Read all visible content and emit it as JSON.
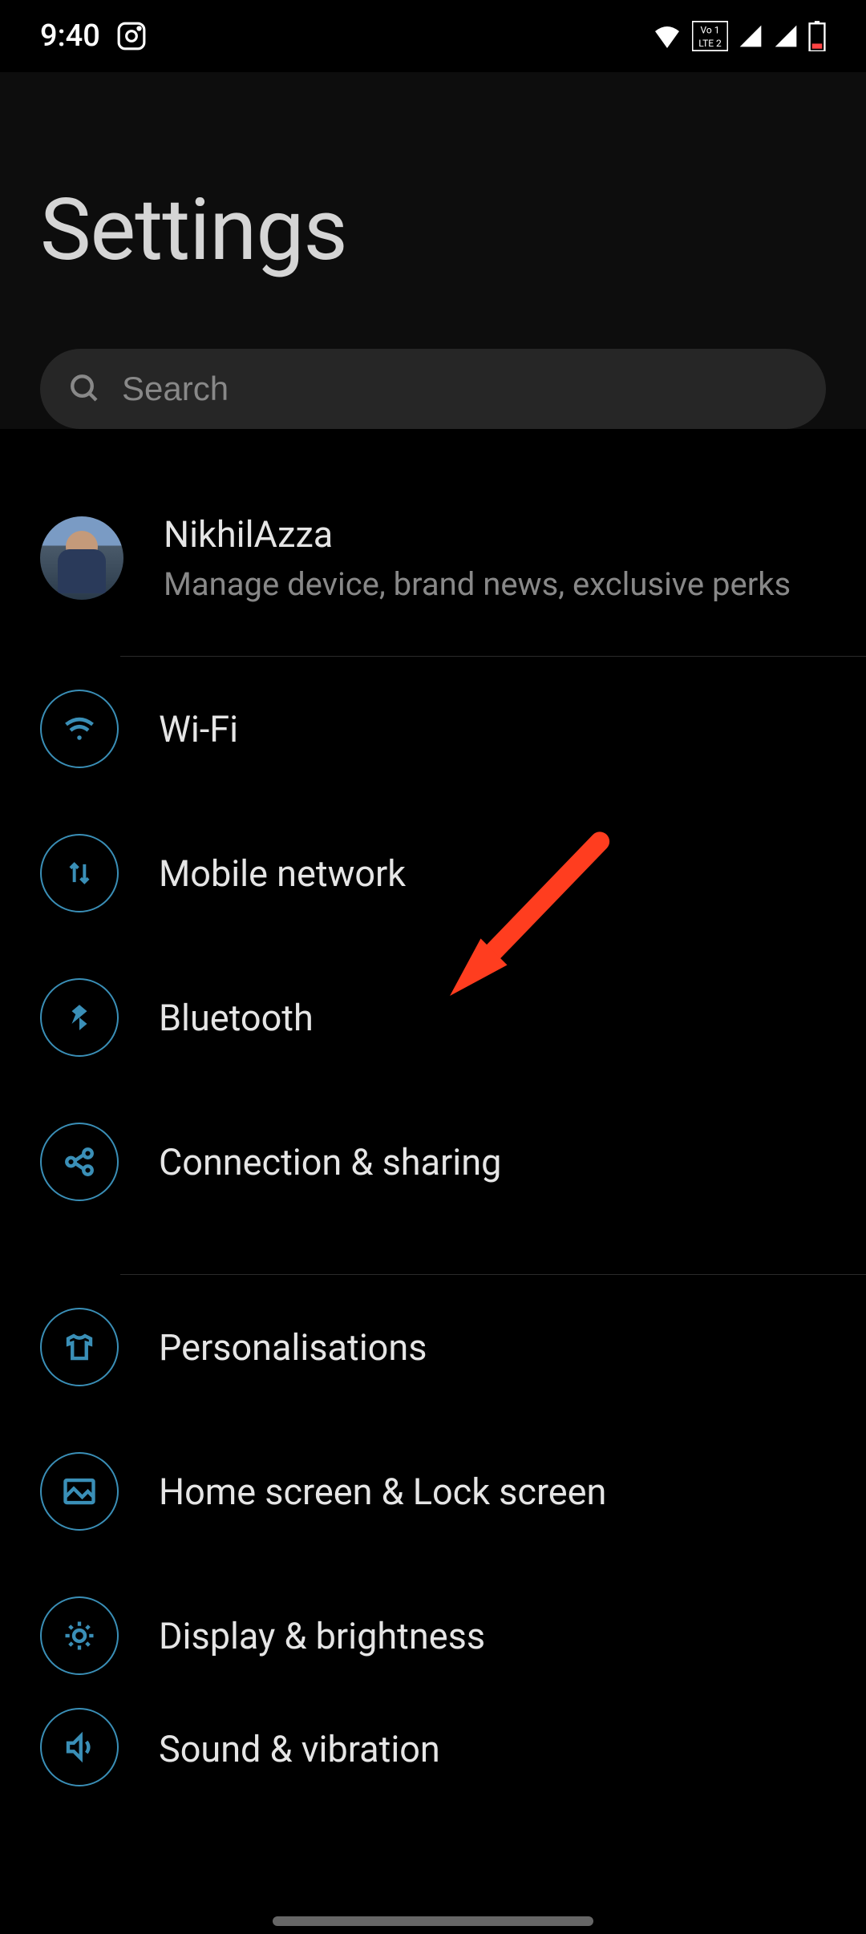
{
  "status": {
    "time": "9:40"
  },
  "header": {
    "title": "Settings"
  },
  "search": {
    "placeholder": "Search"
  },
  "account": {
    "name": "NikhilAzza",
    "subtitle": "Manage device, brand news, exclusive perks"
  },
  "items": [
    {
      "label": "Wi-Fi",
      "icon": "wifi"
    },
    {
      "label": "Mobile network",
      "icon": "mobile-data"
    },
    {
      "label": "Bluetooth",
      "icon": "bluetooth"
    },
    {
      "label": "Connection & sharing",
      "icon": "share"
    },
    {
      "label": "Personalisations",
      "icon": "shirt"
    },
    {
      "label": "Home screen & Lock screen",
      "icon": "image"
    },
    {
      "label": "Display & brightness",
      "icon": "brightness"
    },
    {
      "label": "Sound & vibration",
      "icon": "sound"
    }
  ]
}
